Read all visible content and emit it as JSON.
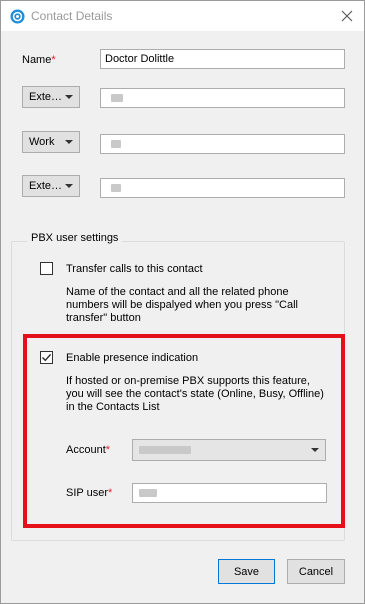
{
  "window": {
    "title": "Contact Details",
    "icons": {
      "app": "app-logo-icon",
      "close": "close-icon"
    }
  },
  "form": {
    "name_label": "Name",
    "required_mark": "*",
    "name_value": "Doctor Dolittle",
    "phone_rows": [
      {
        "type_label": "Exte…"
      },
      {
        "type_label": "Work"
      },
      {
        "type_label": "Exte…"
      }
    ]
  },
  "pbx": {
    "group_title": "PBX user settings",
    "transfer_label": "Transfer calls to this contact",
    "transfer_checked": false,
    "transfer_desc": [
      "Name of the contact and all the related phone",
      "numbers will be dispalyed when you press \"Call",
      "transfer\" button"
    ],
    "presence_label": "Enable presence indication",
    "presence_checked": true,
    "presence_desc": [
      "If hosted or on-premise PBX supports this feature,",
      "you will see the contact's state (Online, Busy, Offline)",
      "in the Contacts List"
    ],
    "account_label": "Account",
    "sip_label": "SIP user"
  },
  "buttons": {
    "save": "Save",
    "cancel": "Cancel"
  },
  "colors": {
    "highlight": "#e5101a",
    "required": "#e0202c",
    "accent": "#0078d7"
  }
}
